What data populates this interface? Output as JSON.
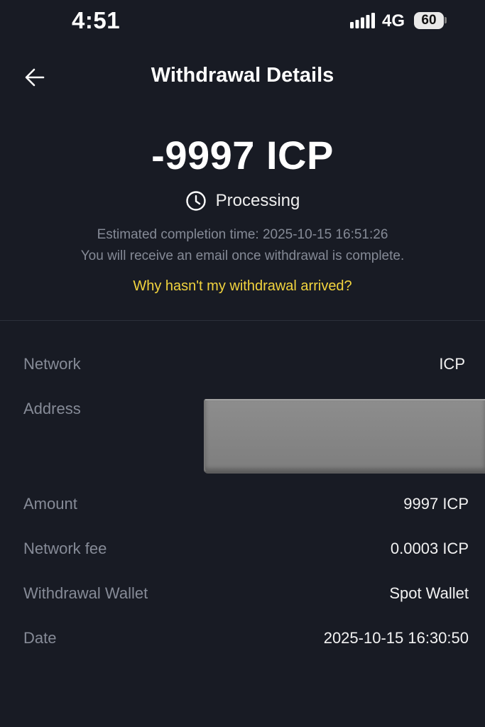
{
  "status_bar": {
    "time": "4:51",
    "network_type": "4G",
    "battery_level": "60"
  },
  "header": {
    "title": "Withdrawal Details",
    "back_icon": "arrow-left-icon"
  },
  "summary": {
    "amount": "-9997 ICP",
    "status": "Processing",
    "status_icon": "clock-icon",
    "eta": "Estimated completion time: 2025-10-15 16:51:26",
    "email_note": "You will receive an email once withdrawal is complete.",
    "help_link": "Why hasn't my withdrawal arrived?"
  },
  "details": [
    {
      "label": "Network",
      "value": "ICP"
    },
    {
      "label": "Address",
      "value": ""
    },
    {
      "label": "Amount",
      "value": "9997 ICP"
    },
    {
      "label": "Network fee",
      "value": "0.0003 ICP"
    },
    {
      "label": "Withdrawal Wallet",
      "value": "Spot Wallet"
    },
    {
      "label": "Date",
      "value": "2025-10-15 16:30:50"
    }
  ],
  "colors": {
    "background": "#181b24",
    "label": "#868b97",
    "link": "#f2d43e",
    "redaction": "#858585"
  }
}
